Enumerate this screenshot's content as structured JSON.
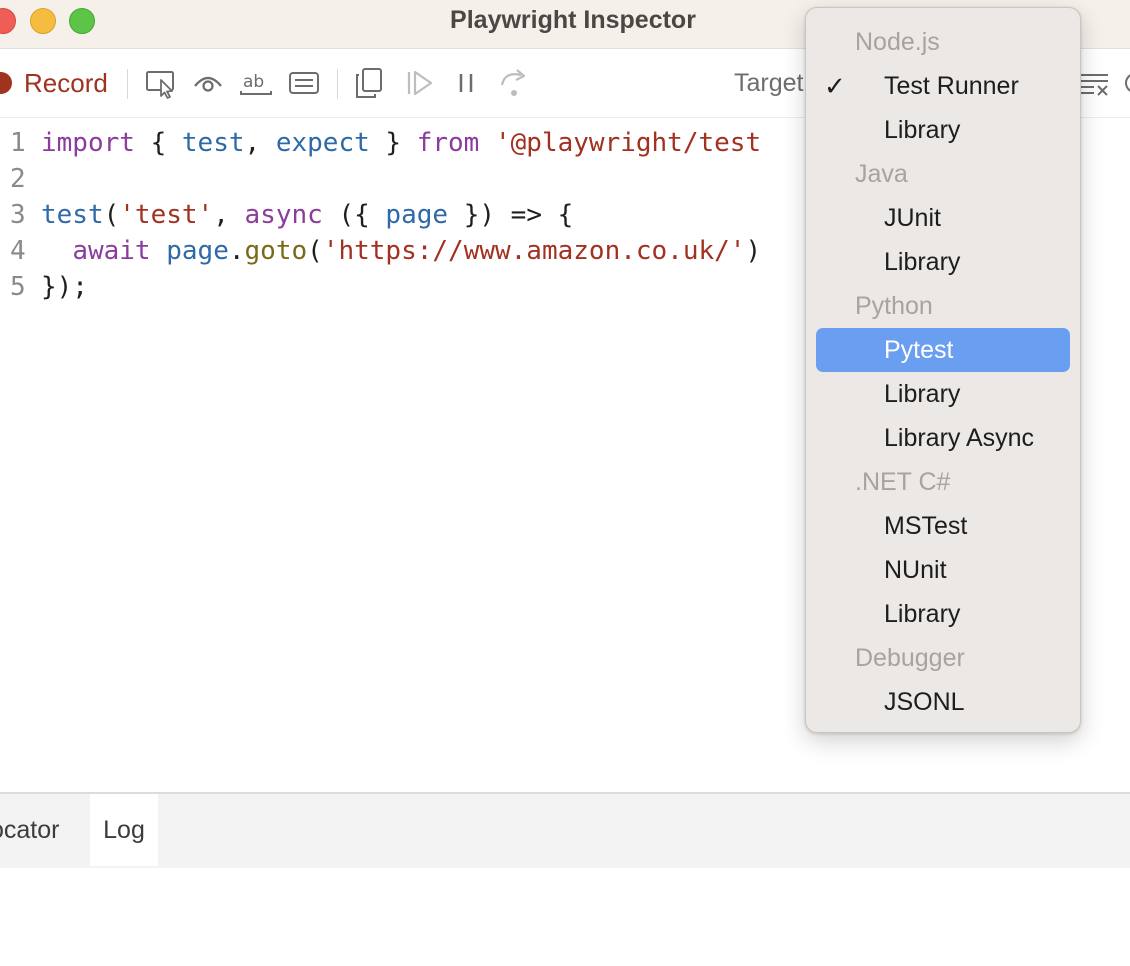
{
  "window": {
    "title": "Playwright Inspector"
  },
  "toolbar": {
    "record_label": "Record",
    "target_label": "Target",
    "icons": [
      "pick-locator-icon",
      "assert-visibility-icon",
      "assert-text-icon",
      "assert-value-icon",
      "copy-icon",
      "resume-icon",
      "pause-icon",
      "step-over-icon",
      "clear-icon"
    ]
  },
  "editor": {
    "lines": [
      {
        "number": "1",
        "tokens": [
          {
            "t": "import",
            "c": "kw"
          },
          {
            "t": " { ",
            "c": ""
          },
          {
            "t": "test",
            "c": "id"
          },
          {
            "t": ", ",
            "c": ""
          },
          {
            "t": "expect",
            "c": "id"
          },
          {
            "t": " } ",
            "c": ""
          },
          {
            "t": "from",
            "c": "kw"
          },
          {
            "t": " ",
            "c": ""
          },
          {
            "t": "'@playwright/test",
            "c": "str"
          }
        ]
      },
      {
        "number": "2",
        "tokens": []
      },
      {
        "number": "3",
        "tokens": [
          {
            "t": "test",
            "c": "id"
          },
          {
            "t": "(",
            "c": ""
          },
          {
            "t": "'test'",
            "c": "str"
          },
          {
            "t": ", ",
            "c": ""
          },
          {
            "t": "async",
            "c": "kw"
          },
          {
            "t": " ({ ",
            "c": ""
          },
          {
            "t": "page",
            "c": "id"
          },
          {
            "t": " }) => {",
            "c": ""
          }
        ]
      },
      {
        "number": "4",
        "tokens": [
          {
            "t": "  ",
            "c": ""
          },
          {
            "t": "await",
            "c": "kw"
          },
          {
            "t": " ",
            "c": ""
          },
          {
            "t": "page",
            "c": "id"
          },
          {
            "t": ".",
            "c": ""
          },
          {
            "t": "goto",
            "c": "fn"
          },
          {
            "t": "(",
            "c": ""
          },
          {
            "t": "'https://www.amazon.co.uk/'",
            "c": "str"
          },
          {
            "t": ")",
            "c": ""
          }
        ]
      },
      {
        "number": "5",
        "tokens": [
          {
            "t": "});",
            "c": ""
          }
        ]
      }
    ]
  },
  "bottom_panel": {
    "tabs": [
      {
        "label": "ocator",
        "active": false
      },
      {
        "label": "Log",
        "active": true
      }
    ]
  },
  "target_menu": {
    "entries": [
      {
        "kind": "group",
        "label": "Node.js"
      },
      {
        "kind": "item",
        "label": "Test Runner",
        "checked": true
      },
      {
        "kind": "item",
        "label": "Library"
      },
      {
        "kind": "group",
        "label": "Java"
      },
      {
        "kind": "item",
        "label": "JUnit"
      },
      {
        "kind": "item",
        "label": "Library"
      },
      {
        "kind": "group",
        "label": "Python"
      },
      {
        "kind": "item",
        "label": "Pytest",
        "highlighted": true
      },
      {
        "kind": "item",
        "label": "Library"
      },
      {
        "kind": "item",
        "label": "Library Async"
      },
      {
        "kind": "group",
        "label": ".NET C#"
      },
      {
        "kind": "item",
        "label": "MSTest"
      },
      {
        "kind": "item",
        "label": "NUnit"
      },
      {
        "kind": "item",
        "label": "Library"
      },
      {
        "kind": "group",
        "label": "Debugger"
      },
      {
        "kind": "item",
        "label": "JSONL"
      }
    ],
    "check_glyph": "✓"
  },
  "colors": {
    "record": "#a0331e",
    "menu_highlight": "#6a9ef0",
    "keyword": "#8b3c9c",
    "identifier": "#2f6aa8",
    "string": "#a33121"
  }
}
